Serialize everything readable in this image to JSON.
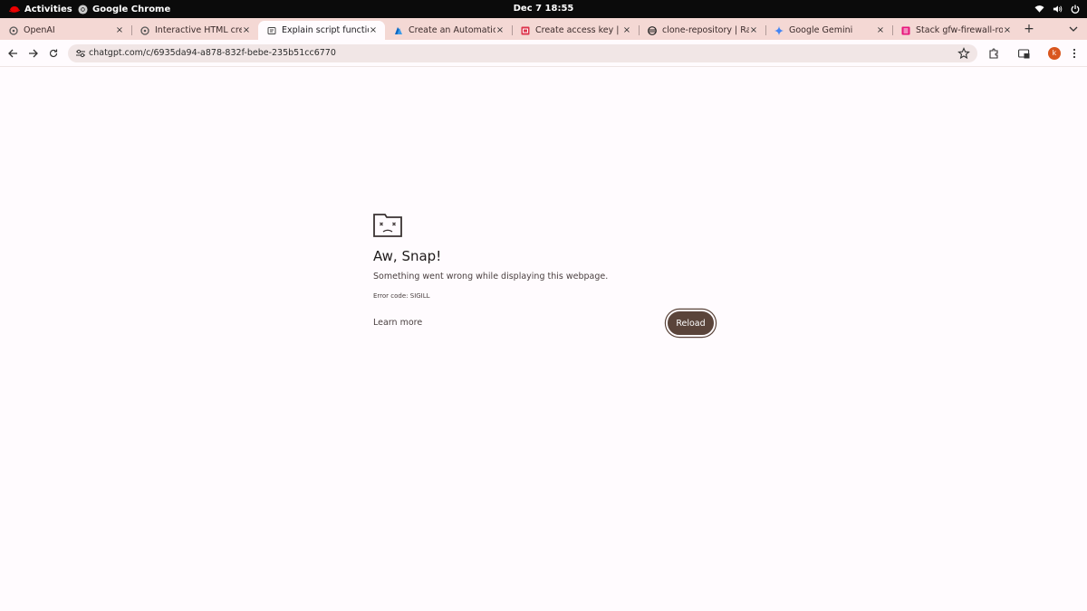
{
  "topbar": {
    "activities": "Activities",
    "app_name": "Google Chrome",
    "clock": "Dec 7  18:55",
    "icons": [
      "wifi-icon",
      "volume-icon",
      "power-icon"
    ]
  },
  "tabs": [
    {
      "title": "OpenAI",
      "icon": "openai-icon",
      "active": false
    },
    {
      "title": "Interactive HTML creat",
      "icon": "openai-icon",
      "active": false
    },
    {
      "title": "Explain script function",
      "icon": "chat-icon",
      "active": true
    },
    {
      "title": "Create an Automatic K",
      "icon": "azure-icon",
      "active": false
    },
    {
      "title": "Create access key | IAM",
      "icon": "aws-icon",
      "active": false
    },
    {
      "title": "clone-repository | Railw",
      "icon": "railway-icon",
      "active": false
    },
    {
      "title": "Google Gemini",
      "icon": "gemini-icon",
      "active": false
    },
    {
      "title": "Stack gfw-firewall-role",
      "icon": "stack-icon",
      "active": false
    }
  ],
  "tab_close_glyph": "×",
  "new_tab_glyph": "+",
  "toolbar": {
    "url": "chatgpt.com/c/6935da94-a878-832f-bebe-235b51cc6770",
    "avatar_initial": "k"
  },
  "crash": {
    "title": "Aw, Snap!",
    "message": "Something went wrong while displaying this webpage.",
    "error_code": "Error code: SIGILL",
    "learn_more": "Learn more",
    "reload": "Reload"
  },
  "colors": {
    "topbar": "#0b0b0b",
    "tabstrip": "#f4d8d4",
    "page_bg": "#fffbfe",
    "reload_button": "#5a443a",
    "avatar": "#d9561e"
  }
}
